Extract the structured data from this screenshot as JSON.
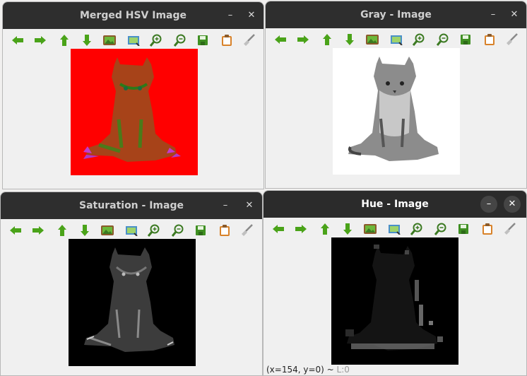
{
  "windows": {
    "merged": {
      "title": "Merged HSV Image"
    },
    "gray": {
      "title": "Gray - Image"
    },
    "saturation": {
      "title": "Saturation - Image"
    },
    "hue": {
      "title": "Hue - Image",
      "status_coords": "(x=154, y=0) ~",
      "status_level": "L:0"
    }
  },
  "window_controls": {
    "minimize": "–",
    "close": "✕"
  },
  "toolbar": [
    "arrow-left-icon",
    "arrow-right-icon",
    "arrow-up-icon",
    "arrow-down-icon",
    "image-icon",
    "screenshot-icon",
    "zoom-in-icon",
    "zoom-out-icon",
    "save-icon",
    "clipboard-icon",
    "brush-icon"
  ],
  "colors": {
    "merged_bg": "#ff0000",
    "cat_tint": "#7a6a20",
    "toolbar_green": "#4aa319",
    "titlebar": "#2e2e2e"
  }
}
